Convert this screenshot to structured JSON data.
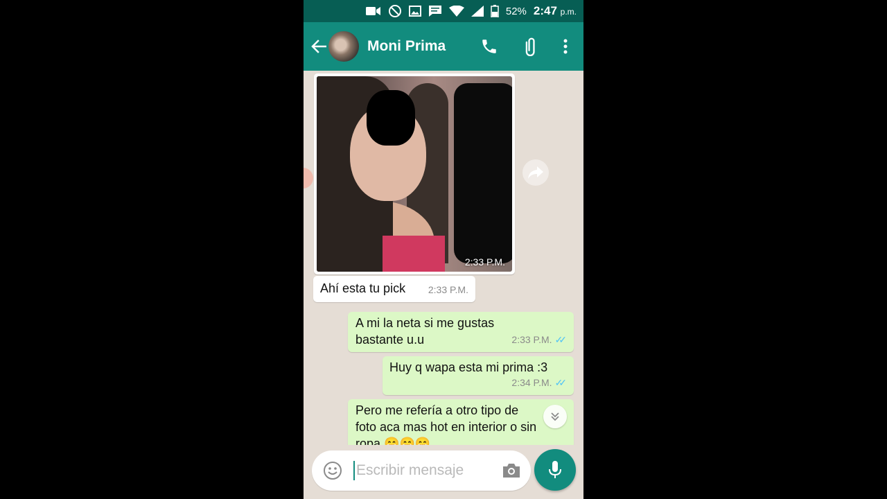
{
  "status_bar": {
    "battery": "52%",
    "time": "2:47",
    "ampm": "p.m."
  },
  "header": {
    "contact_name": "Moni Prima"
  },
  "messages": [
    {
      "type": "image",
      "direction": "incoming",
      "time": "2:33 P.M."
    },
    {
      "type": "text",
      "direction": "incoming",
      "text": "Ahí esta tu pick",
      "time": "2:33 P.M."
    },
    {
      "type": "text",
      "direction": "outgoing",
      "text_lines": [
        "A mi la neta si me gustas",
        "bastante u.u"
      ],
      "time": "2:33 P.M.",
      "status": "read"
    },
    {
      "type": "text",
      "direction": "outgoing",
      "text": "Huy q wapa esta mi prima :3",
      "time": "2:34 P.M.",
      "status": "read"
    },
    {
      "type": "text",
      "direction": "outgoing",
      "text_lines": [
        "Pero me refería a otro tipo de",
        "foto aca mas hot en interior o sin",
        "ropa 😁😁😁"
      ]
    }
  ],
  "composer": {
    "placeholder": "Escribir mensaje"
  },
  "colors": {
    "header": "#128c7e",
    "status_bar": "#075e54",
    "outgoing_bubble": "#dcf8c6",
    "chat_background": "#e5ddd5",
    "read_ticks": "#4fc3f7"
  },
  "icons": {
    "back": "arrow-left-icon",
    "call": "phone-icon",
    "attach": "paperclip-icon",
    "menu": "more-vert-icon",
    "forward": "forward-icon",
    "scroll": "double-chevron-down-icon",
    "emoji": "emoji-icon",
    "camera": "camera-icon",
    "mic": "mic-icon"
  }
}
